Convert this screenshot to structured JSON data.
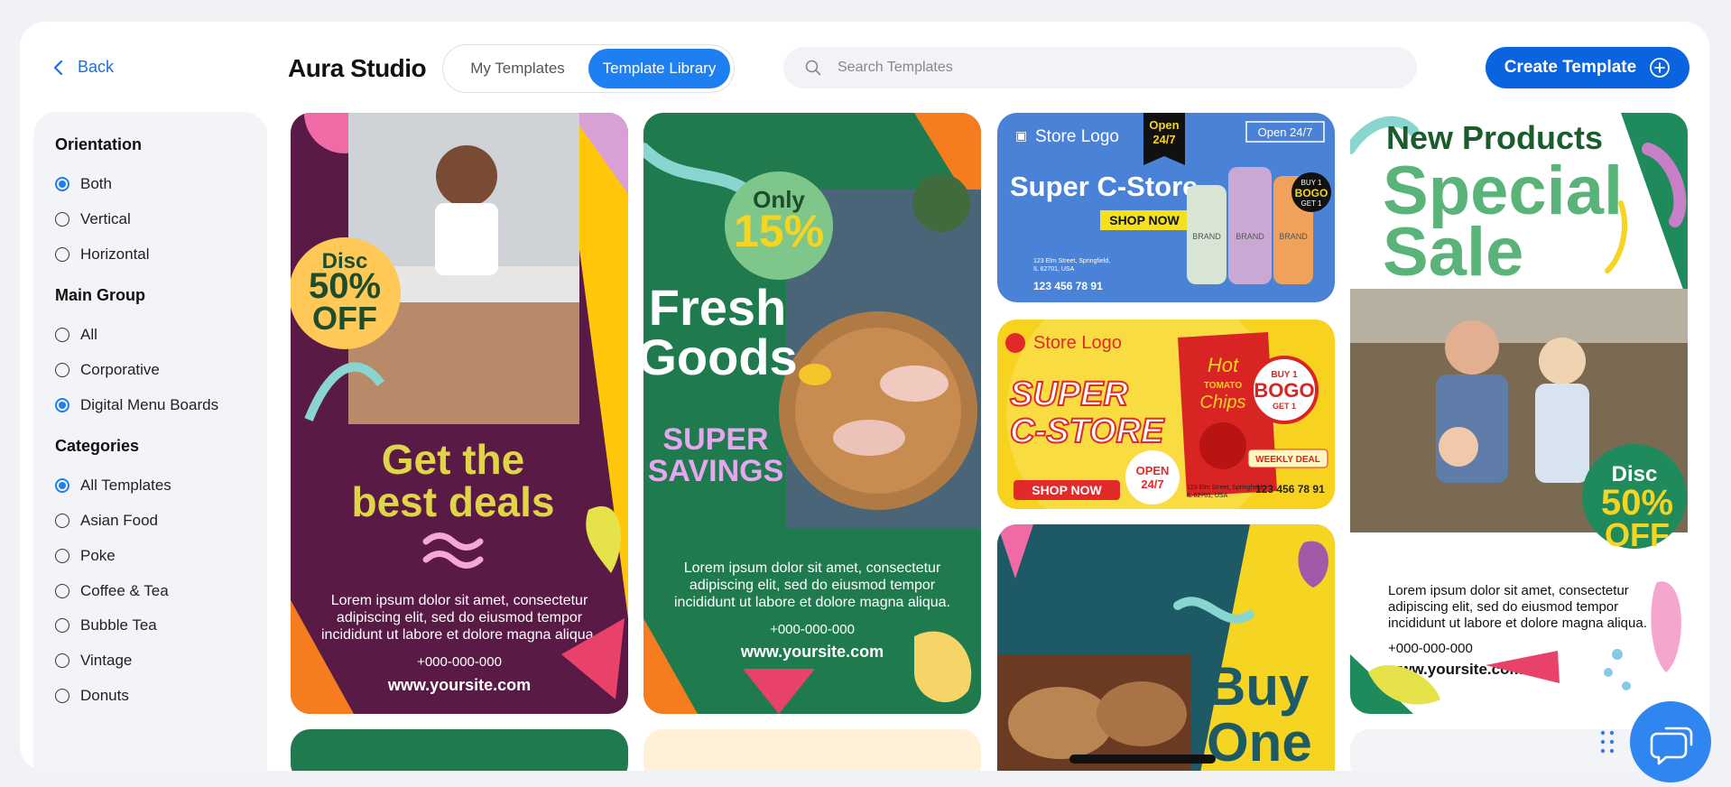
{
  "header": {
    "back_label": "Back",
    "app_title": "Aura Studio",
    "tabs": [
      {
        "label": "My Templates"
      },
      {
        "label": "Template Library"
      }
    ],
    "search_placeholder": "Search Templates",
    "create_label": "Create Template"
  },
  "sidebar": {
    "orientation": {
      "title": "Orientation",
      "options": [
        {
          "label": "Both",
          "selected": true
        },
        {
          "label": "Vertical",
          "selected": false
        },
        {
          "label": "Horizontal",
          "selected": false
        }
      ]
    },
    "main_group": {
      "title": "Main Group",
      "options": [
        {
          "label": "All",
          "selected": false
        },
        {
          "label": "Corporative",
          "selected": false
        },
        {
          "label": "Digital Menu Boards",
          "selected": true
        }
      ]
    },
    "categories": {
      "title": "Categories",
      "options": [
        {
          "label": "All Templates",
          "selected": true
        },
        {
          "label": "Asian Food",
          "selected": false
        },
        {
          "label": "Poke",
          "selected": false
        },
        {
          "label": "Coffee & Tea",
          "selected": false
        },
        {
          "label": "Bubble Tea",
          "selected": false
        },
        {
          "label": "Vintage",
          "selected": false
        },
        {
          "label": "Donuts",
          "selected": false
        }
      ]
    }
  },
  "templates": {
    "t1": {
      "disc": "Disc",
      "pct": "50%",
      "off": "OFF",
      "headline1": "Get the",
      "headline2": "best deals",
      "body1": "Lorem ipsum dolor sit amet, consectetur",
      "body2": "adipiscing elit, sed do eiusmod tempor",
      "body3": "incididunt ut labore et dolore magna aliqua.",
      "phone": "+000-000-000",
      "site": "www.yoursite.com"
    },
    "t2": {
      "only": "Only",
      "pct": "15%",
      "h1": "Fresh",
      "h2": "Goods",
      "s1": "SUPER",
      "s2": "SAVINGS",
      "body1": "Lorem ipsum dolor sit amet, consectetur",
      "body2": "adipiscing elit, sed do eiusmod tempor",
      "body3": "incididunt ut labore et dolore magna aliqua.",
      "phone": "+000-000-000",
      "site": "www.yoursite.com"
    },
    "t3": {
      "logo": "Store Logo",
      "open1": "Open",
      "open2": "24/7",
      "open_badge": "Open 24/7",
      "title": "Super C-Store",
      "shop": "SHOP NOW",
      "addr1": "123 Elm Street, Springfield,",
      "addr2": "IL 62701, USA",
      "phone": "123 456 78 91",
      "buy1": "BUY 1",
      "bogo": "BOGO",
      "get1": "GET 1",
      "brand": "BRAND"
    },
    "t4": {
      "logo": "Store Logo",
      "super": "SUPER",
      "cstore": "C-STORE",
      "shop": "SHOP NOW",
      "open1": "OPEN",
      "open2": "24/7",
      "chips1": "Hot",
      "chips2": "TOMATO",
      "chips3": "Chips",
      "buy1": "BUY 1",
      "bogo": "BOGO",
      "get1": "GET 1",
      "weekly": "WEEKLY DEAL",
      "addr1": "123 Elm Street, Springfield,",
      "addr2": "IL 62701, USA",
      "phone": "123 456 78 91"
    },
    "t5": {
      "buy": "Buy",
      "one": "One"
    },
    "t6": {
      "h1": "New Products",
      "h2": "Special",
      "h3": "Sale",
      "disc": "Disc",
      "pct": "50%",
      "off": "OFF",
      "body1": "Lorem ipsum dolor sit amet, consectetur",
      "body2": "adipiscing elit, sed do eiusmod tempor",
      "body3": "incididunt ut labore et dolore magna aliqua.",
      "phone": "+000-000-000",
      "site": "www.yoursite.com"
    }
  },
  "colors": {
    "accent": "#1e7ff0",
    "create": "#0a64df"
  }
}
